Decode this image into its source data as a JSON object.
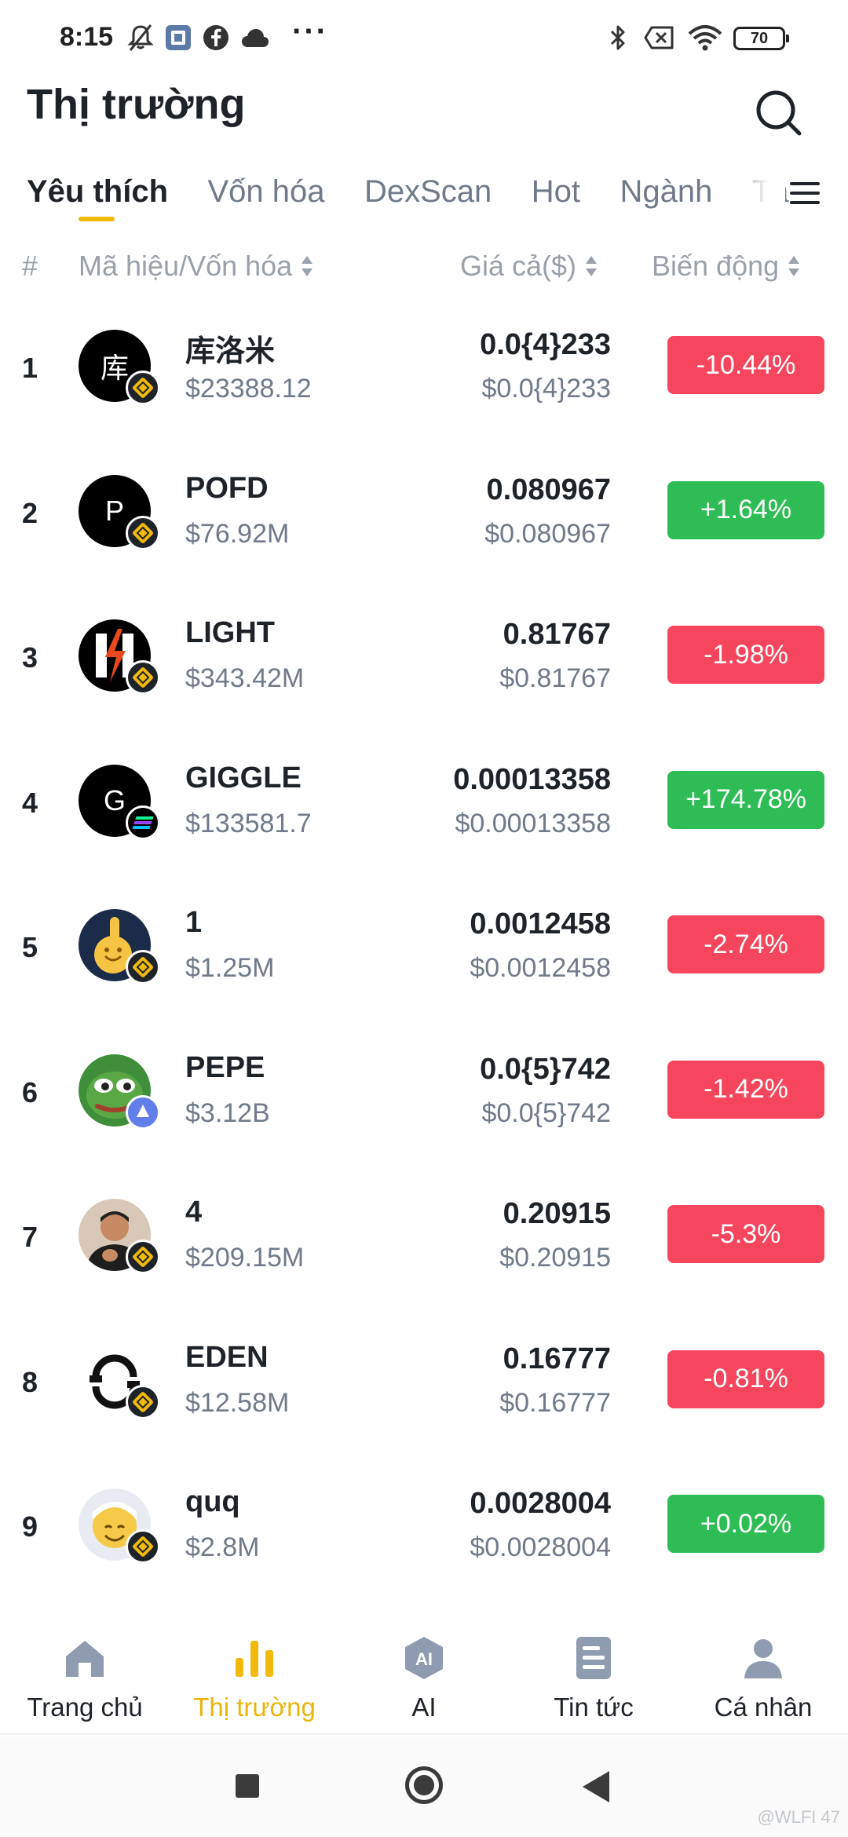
{
  "status_bar": {
    "time": "8:15",
    "battery": "70",
    "more": "···"
  },
  "header": {
    "title": "Thị trường"
  },
  "tabs": [
    {
      "label": "Yêu thích",
      "active": true
    },
    {
      "label": "Vốn hóa",
      "active": false
    },
    {
      "label": "DexScan",
      "active": false
    },
    {
      "label": "Hot",
      "active": false
    },
    {
      "label": "Ngành",
      "active": false
    },
    {
      "label": "Tầ",
      "active": false
    }
  ],
  "columns": {
    "rank": "#",
    "symbol": "Mã hiệu/Vốn hóa",
    "price": "Giá cả($)",
    "change": "Biến động"
  },
  "rows": [
    {
      "rank": "1",
      "avatar": "库",
      "symbol": "库洛米",
      "mcap": "$23388.12",
      "price": "0.0{4}233",
      "price_usd": "$0.0{4}233",
      "change": "-10.44%",
      "direction": "down",
      "chain": "bnb"
    },
    {
      "rank": "2",
      "avatar": "P",
      "symbol": "POFD",
      "mcap": "$76.92M",
      "price": "0.080967",
      "price_usd": "$0.080967",
      "change": "+1.64%",
      "direction": "up",
      "chain": "bnb"
    },
    {
      "rank": "3",
      "avatar": "",
      "symbol": "LIGHT",
      "mcap": "$343.42M",
      "price": "0.81767",
      "price_usd": "$0.81767",
      "change": "-1.98%",
      "direction": "down",
      "chain": "bnb"
    },
    {
      "rank": "4",
      "avatar": "G",
      "symbol": "GIGGLE",
      "mcap": "$133581.7",
      "price": "0.00013358",
      "price_usd": "$0.00013358",
      "change": "+174.78%",
      "direction": "up",
      "chain": "sol"
    },
    {
      "rank": "5",
      "avatar": "",
      "symbol": "1",
      "mcap": "$1.25M",
      "price": "0.0012458",
      "price_usd": "$0.0012458",
      "change": "-2.74%",
      "direction": "down",
      "chain": "bnb"
    },
    {
      "rank": "6",
      "avatar": "",
      "symbol": "PEPE",
      "mcap": "$3.12B",
      "price": "0.0{5}742",
      "price_usd": "$0.0{5}742",
      "change": "-1.42%",
      "direction": "down",
      "chain": "eth"
    },
    {
      "rank": "7",
      "avatar": "",
      "symbol": "4",
      "mcap": "$209.15M",
      "price": "0.20915",
      "price_usd": "$0.20915",
      "change": "-5.3%",
      "direction": "down",
      "chain": "bnb"
    },
    {
      "rank": "8",
      "avatar": "",
      "symbol": "EDEN",
      "mcap": "$12.58M",
      "price": "0.16777",
      "price_usd": "$0.16777",
      "change": "-0.81%",
      "direction": "down",
      "chain": "bnb"
    },
    {
      "rank": "9",
      "avatar": "",
      "symbol": "quq",
      "mcap": "$2.8M",
      "price": "0.0028004",
      "price_usd": "$0.0028004",
      "change": "+0.02%",
      "direction": "up",
      "chain": "bnb"
    }
  ],
  "bottom_nav": [
    {
      "label": "Trang chủ",
      "icon": "home-icon",
      "active": false
    },
    {
      "label": "Thị trường",
      "icon": "markets-icon",
      "active": true
    },
    {
      "label": "AI",
      "icon": "ai-icon",
      "active": false
    },
    {
      "label": "Tin tức",
      "icon": "news-icon",
      "active": false
    },
    {
      "label": "Cá nhân",
      "icon": "profile-icon",
      "active": false
    }
  ],
  "watermark": "@WLFI 47",
  "colors": {
    "accent": "#f0b90b",
    "up": "#2ebd55",
    "down": "#f6465d",
    "text": "#1e2329",
    "muted": "#707a8a"
  }
}
